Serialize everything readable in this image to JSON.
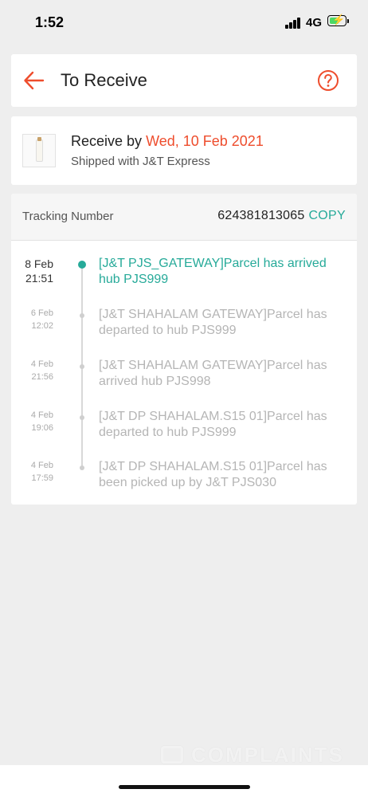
{
  "status_bar": {
    "time": "1:52",
    "network": "4G"
  },
  "header": {
    "title": "To Receive",
    "back_icon": "arrow-left-icon",
    "help_icon": "question-circle-icon",
    "accent_color": "#ee4d2d"
  },
  "shipment": {
    "receive_prefix": "Receive by",
    "receive_date": "Wed, 10 Feb 2021",
    "shipped_with": "Shipped with J&T Express"
  },
  "tracking": {
    "label": "Tracking Number",
    "number": "624381813065",
    "copy_label": "COPY",
    "accent_color": "#26aa99",
    "events": [
      {
        "date": "8 Feb",
        "time": "21:51",
        "text": "[J&T PJS_GATEWAY]Parcel has arrived hub PJS999",
        "active": true
      },
      {
        "date": "6 Feb",
        "time": "12:02",
        "text": "[J&T SHAHALAM GATEWAY]Parcel has departed to hub PJS999",
        "active": false
      },
      {
        "date": "4 Feb",
        "time": "21:56",
        "text": "[J&T SHAHALAM GATEWAY]Parcel has arrived hub PJS998",
        "active": false
      },
      {
        "date": "4 Feb",
        "time": "19:06",
        "text": "[J&T DP SHAHALAM.S15 01]Parcel has departed to hub PJS999",
        "active": false
      },
      {
        "date": "4 Feb",
        "time": "17:59",
        "text": "[J&T DP SHAHALAM.S15 01]Parcel has been picked up by J&T PJS030",
        "active": false
      }
    ]
  },
  "watermark": {
    "text": "COMPLAINTS"
  }
}
